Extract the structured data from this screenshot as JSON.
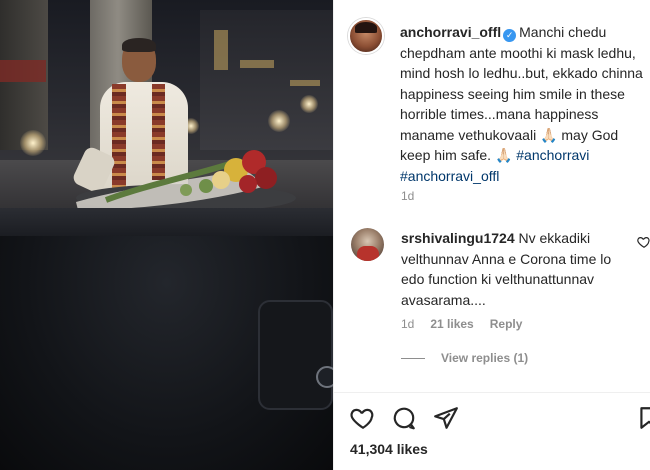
{
  "post": {
    "author": {
      "username": "anchorravi_offl",
      "verified": true
    },
    "caption": {
      "text": "Manchi chedu chepdham ante moothi ki mask ledhu, mind hosh lo ledhu..but, ekkado chinna happiness seeing him smile in these horrible times...mana happiness maname vethukovaali 🙏🏻 may God keep him safe. 🙏🏻 ",
      "hashtags": [
        "#anchorravi",
        "#anchorravi_offl"
      ],
      "time": "1d"
    },
    "comments": [
      {
        "username": "srshivalingu1724",
        "text": "Nv ekkadiki velthunnav Anna e Corona time lo edo function ki velthunattunnav avasarama....",
        "time": "1d",
        "likes": "21 likes",
        "reply_label": "Reply",
        "view_replies": "View replies (1)"
      }
    ],
    "likes": "41,304 likes",
    "icons": {
      "like": "heart-icon",
      "comment": "comment-icon",
      "share": "share-icon",
      "save": "bookmark-icon",
      "verified": "verified-badge-icon"
    },
    "colors": {
      "text": "#262626",
      "muted": "#8e8e8e",
      "hashtag": "#00376b",
      "verified": "#3897f0"
    }
  }
}
